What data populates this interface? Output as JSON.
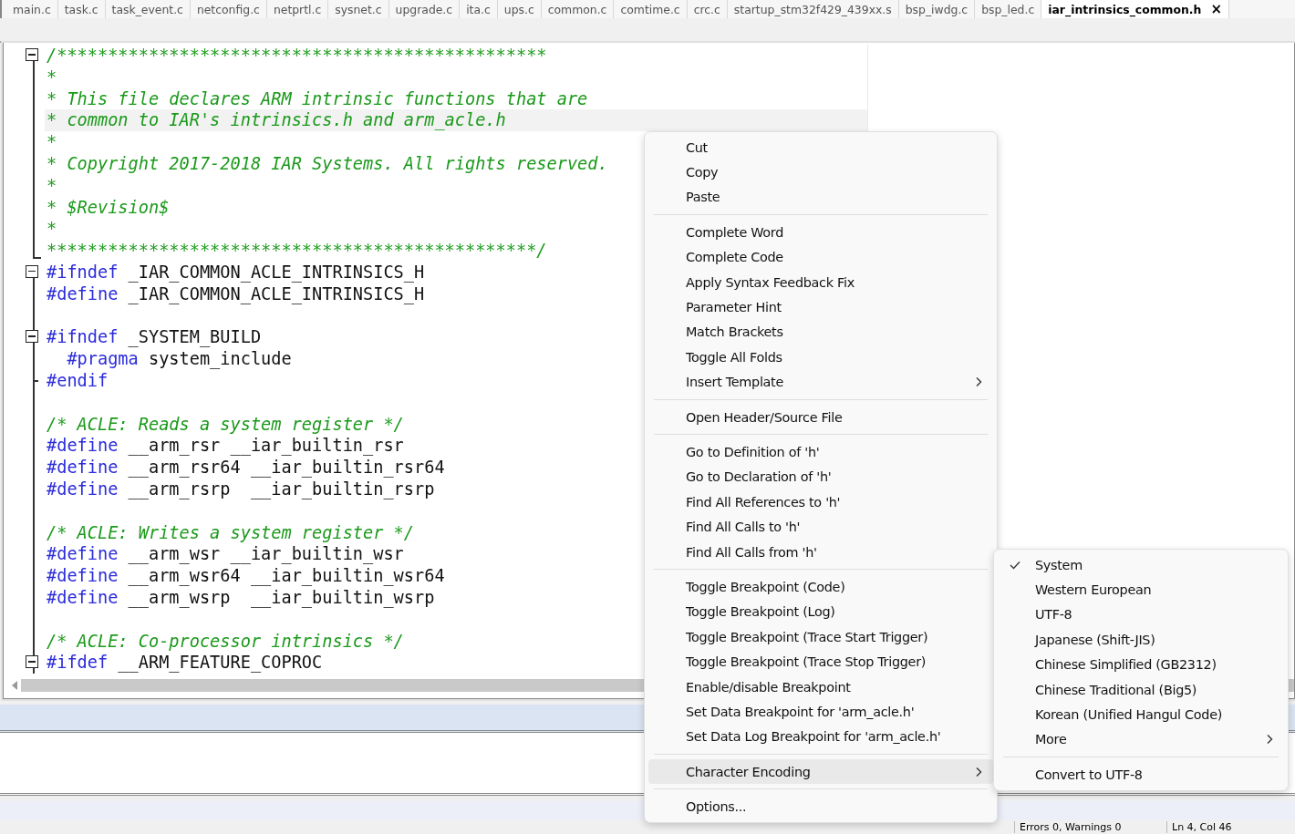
{
  "tabs": [
    {
      "label": "main.c",
      "selected": false
    },
    {
      "label": "task.c",
      "selected": false
    },
    {
      "label": "task_event.c",
      "selected": false
    },
    {
      "label": "netconfig.c",
      "selected": false
    },
    {
      "label": "netprtl.c",
      "selected": false
    },
    {
      "label": "sysnet.c",
      "selected": false
    },
    {
      "label": "upgrade.c",
      "selected": false
    },
    {
      "label": "ita.c",
      "selected": false
    },
    {
      "label": "ups.c",
      "selected": false
    },
    {
      "label": "common.c",
      "selected": false
    },
    {
      "label": "comtime.c",
      "selected": false
    },
    {
      "label": "crc.c",
      "selected": false
    },
    {
      "label": "startup_stm32f429_439xx.s",
      "selected": false
    },
    {
      "label": "bsp_iwdg.c",
      "selected": false
    },
    {
      "label": "bsp_led.c",
      "selected": false
    },
    {
      "label": "iar_intrinsics_common.h",
      "selected": true,
      "close": "×"
    }
  ],
  "editor": {
    "lines": [
      {
        "kind": "start",
        "current": false,
        "segments": [
          {
            "kind": "comment",
            "text": "/************************************************"
          }
        ]
      },
      {
        "kind": "body",
        "current": false,
        "segments": [
          {
            "kind": "comment",
            "text": "*"
          }
        ]
      },
      {
        "kind": "body",
        "current": false,
        "segments": [
          {
            "kind": "comment",
            "text": "* This file declares ARM intrinsic functions that are"
          }
        ]
      },
      {
        "kind": "body",
        "current": true,
        "segments": [
          {
            "kind": "comment",
            "text": "* common to IAR's intrinsics.h and arm_acle.h"
          }
        ]
      },
      {
        "kind": "body",
        "current": false,
        "segments": [
          {
            "kind": "comment",
            "text": "*"
          }
        ]
      },
      {
        "kind": "body",
        "current": false,
        "segments": [
          {
            "kind": "comment",
            "text": "* Copyright 2017-2018 IAR Systems. All rights reserved."
          }
        ]
      },
      {
        "kind": "body",
        "current": false,
        "segments": [
          {
            "kind": "comment",
            "text": "*"
          }
        ]
      },
      {
        "kind": "body",
        "current": false,
        "segments": [
          {
            "kind": "comment",
            "text": "* $Revision$"
          }
        ]
      },
      {
        "kind": "body",
        "current": false,
        "segments": [
          {
            "kind": "comment",
            "text": "*"
          }
        ]
      },
      {
        "kind": "end",
        "current": false,
        "segments": [
          {
            "kind": "comment",
            "text": "************************************************/"
          }
        ]
      },
      {
        "kind": "start",
        "current": false,
        "segments": [
          {
            "kind": "keyword",
            "text": "#ifndef"
          },
          {
            "kind": "plain",
            "text": " _IAR_COMMON_ACLE_INTRINSICS_H"
          }
        ]
      },
      {
        "kind": "body",
        "current": false,
        "segments": [
          {
            "kind": "keyword",
            "text": "#define"
          },
          {
            "kind": "plain",
            "text": " _IAR_COMMON_ACLE_INTRINSICS_H"
          }
        ]
      },
      {
        "kind": "body",
        "current": false
      },
      {
        "kind": "start",
        "current": false,
        "segments": [
          {
            "kind": "keyword",
            "text": "#ifndef"
          },
          {
            "kind": "plain",
            "text": " _SYSTEM_BUILD"
          }
        ]
      },
      {
        "kind": "body",
        "current": false,
        "segments": [
          {
            "kind": "keyword",
            "text": "  #pragma"
          },
          {
            "kind": "plain",
            "text": " system_include"
          }
        ]
      },
      {
        "kind": "tick",
        "current": false,
        "segments": [
          {
            "kind": "keyword",
            "text": "#endif"
          }
        ]
      },
      {
        "kind": "body",
        "current": false
      },
      {
        "kind": "body",
        "current": false,
        "segments": [
          {
            "kind": "comment",
            "text": "/* ACLE: Reads a system register */"
          }
        ]
      },
      {
        "kind": "body",
        "current": false,
        "segments": [
          {
            "kind": "keyword",
            "text": "#define"
          },
          {
            "kind": "plain",
            "text": " __arm_rsr __iar_builtin_rsr"
          }
        ]
      },
      {
        "kind": "body",
        "current": false,
        "segments": [
          {
            "kind": "keyword",
            "text": "#define"
          },
          {
            "kind": "plain",
            "text": " __arm_rsr64 __iar_builtin_rsr64"
          }
        ]
      },
      {
        "kind": "body",
        "current": false,
        "segments": [
          {
            "kind": "keyword",
            "text": "#define"
          },
          {
            "kind": "plain",
            "text": " __arm_rsrp  __iar_builtin_rsrp"
          }
        ]
      },
      {
        "kind": "body",
        "current": false
      },
      {
        "kind": "body",
        "current": false,
        "segments": [
          {
            "kind": "comment",
            "text": "/* ACLE: Writes a system register */"
          }
        ]
      },
      {
        "kind": "body",
        "current": false,
        "segments": [
          {
            "kind": "keyword",
            "text": "#define"
          },
          {
            "kind": "plain",
            "text": " __arm_wsr __iar_builtin_wsr"
          }
        ]
      },
      {
        "kind": "body",
        "current": false,
        "segments": [
          {
            "kind": "keyword",
            "text": "#define"
          },
          {
            "kind": "plain",
            "text": " __arm_wsr64 __iar_builtin_wsr64"
          }
        ]
      },
      {
        "kind": "body",
        "current": false,
        "segments": [
          {
            "kind": "keyword",
            "text": "#define"
          },
          {
            "kind": "plain",
            "text": " __arm_wsrp  __iar_builtin_wsrp"
          }
        ]
      },
      {
        "kind": "body",
        "current": false
      },
      {
        "kind": "body",
        "current": false,
        "segments": [
          {
            "kind": "comment",
            "text": "/* ACLE: Co-processor intrinsics */"
          }
        ]
      },
      {
        "kind": "start",
        "current": false,
        "segments": [
          {
            "kind": "keyword",
            "text": "#ifdef"
          },
          {
            "kind": "plain",
            "text": " __ARM_FEATURE_COPROC"
          }
        ]
      }
    ]
  },
  "context_menu": {
    "groups": [
      [
        {
          "label": "Cut",
          "submenu": false,
          "selected": false
        },
        {
          "label": "Copy",
          "submenu": false,
          "selected": false
        },
        {
          "label": "Paste",
          "submenu": false,
          "selected": false
        }
      ],
      [
        {
          "label": "Complete Word",
          "submenu": false,
          "selected": false
        },
        {
          "label": "Complete Code",
          "submenu": false,
          "selected": false
        },
        {
          "label": "Apply Syntax Feedback Fix",
          "submenu": false,
          "selected": false
        },
        {
          "label": "Parameter Hint",
          "submenu": false,
          "selected": false
        },
        {
          "label": "Match Brackets",
          "submenu": false,
          "selected": false
        },
        {
          "label": "Toggle All Folds",
          "submenu": false,
          "selected": false
        },
        {
          "label": "Insert Template",
          "submenu": true,
          "selected": false
        }
      ],
      [
        {
          "label": "Open Header/Source File",
          "submenu": false,
          "selected": false
        }
      ],
      [
        {
          "label": "Go to Definition of 'h'",
          "submenu": false,
          "selected": false
        },
        {
          "label": "Go to Declaration of 'h'",
          "submenu": false,
          "selected": false
        },
        {
          "label": "Find All References to 'h'",
          "submenu": false,
          "selected": false
        },
        {
          "label": "Find All Calls to 'h'",
          "submenu": false,
          "selected": false
        },
        {
          "label": "Find All Calls from 'h'",
          "submenu": false,
          "selected": false
        }
      ],
      [
        {
          "label": "Toggle Breakpoint (Code)",
          "submenu": false,
          "selected": false
        },
        {
          "label": "Toggle Breakpoint (Log)",
          "submenu": false,
          "selected": false
        },
        {
          "label": "Toggle Breakpoint (Trace Start Trigger)",
          "submenu": false,
          "selected": false
        },
        {
          "label": "Toggle Breakpoint (Trace Stop Trigger)",
          "submenu": false,
          "selected": false
        },
        {
          "label": "Enable/disable Breakpoint",
          "submenu": false,
          "selected": false
        },
        {
          "label": "Set Data Breakpoint for 'arm_acle.h'",
          "submenu": false,
          "selected": false
        },
        {
          "label": "Set Data Log Breakpoint for 'arm_acle.h'",
          "submenu": false,
          "selected": false
        }
      ],
      [
        {
          "label": "Character Encoding",
          "submenu": true,
          "selected": true
        }
      ],
      [
        {
          "label": "Options...",
          "submenu": false,
          "selected": false
        }
      ]
    ]
  },
  "encoding_submenu": {
    "groups": [
      [
        {
          "label": "System",
          "checked": true,
          "submenu": false
        },
        {
          "label": "Western European",
          "checked": false,
          "submenu": false
        },
        {
          "label": "UTF-8",
          "checked": false,
          "submenu": false
        },
        {
          "label": "Japanese (Shift-JIS)",
          "checked": false,
          "submenu": false
        },
        {
          "label": "Chinese Simplified (GB2312)",
          "checked": false,
          "submenu": false
        },
        {
          "label": "Chinese Traditional (Big5)",
          "checked": false,
          "submenu": false
        },
        {
          "label": "Korean (Unified Hangul Code)",
          "checked": false,
          "submenu": false
        },
        {
          "label": "More",
          "checked": false,
          "submenu": true
        }
      ],
      [
        {
          "label": "Convert to UTF-8",
          "checked": false,
          "submenu": false
        }
      ]
    ]
  },
  "status_bar": {
    "errors": "Errors 0, Warnings 0",
    "position": "Ln 4, Col 46"
  }
}
